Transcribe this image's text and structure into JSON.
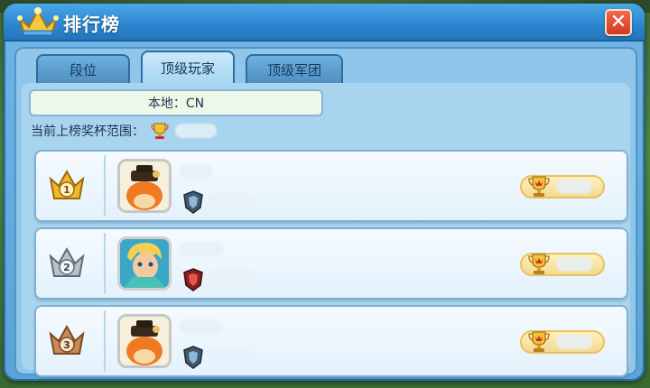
{
  "window": {
    "title": "排行榜"
  },
  "tabs": [
    {
      "label": "段位",
      "active": false
    },
    {
      "label": "顶级玩家",
      "active": true
    },
    {
      "label": "顶级军团",
      "active": false
    }
  ],
  "region": {
    "label": "本地：CN"
  },
  "trophy_range": {
    "label": "当前上榜奖杯范围："
  },
  "ranking": [
    {
      "rank": "1",
      "crown_color": "#f0b82a",
      "avatar": "fox-helmet-avatar",
      "emblem": "shield-emblem-blue"
    },
    {
      "rank": "2",
      "crown_color": "#b7c3cc",
      "avatar": "hero-blonde-avatar",
      "emblem": "shield-emblem-red"
    },
    {
      "rank": "3",
      "crown_color": "#c98a55",
      "avatar": "fox-helmet-avatar",
      "emblem": "shield-emblem-blue"
    }
  ],
  "colors": {
    "panel": "#5aa3d8",
    "title_bar": "#2b86cf",
    "close_button": "#d03a24",
    "row_background": "#eef7fd",
    "trophy_pill": "#f3d88a"
  }
}
